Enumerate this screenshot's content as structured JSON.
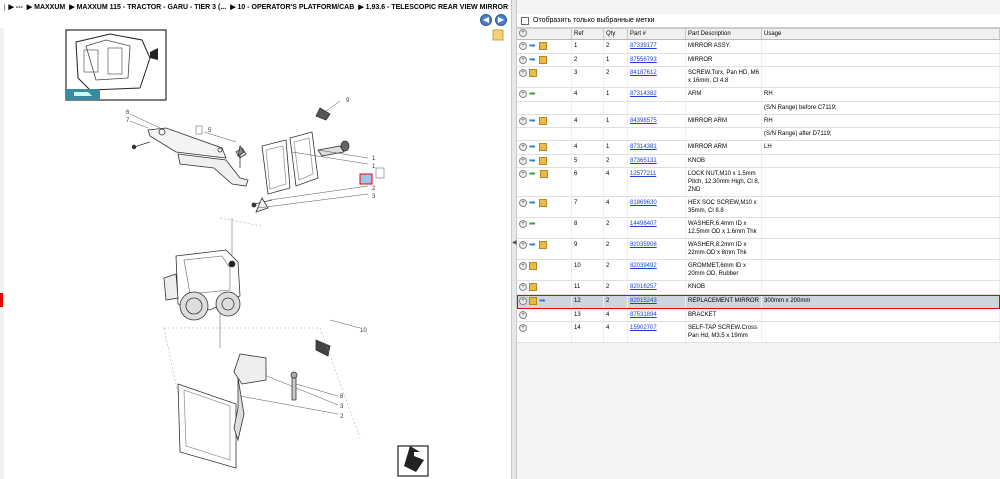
{
  "breadcrumb": {
    "items": [
      "---",
      "MAXXUM",
      "MAXXUM 115 - TRACTOR - GARU - TIER 3 (...",
      "10 - OPERATOR'S PLATFORM/CAB",
      "1.93.6 - TELESCOPIC REAR VIEW MIRROR"
    ]
  },
  "filter": {
    "label": "Отобразить только выбранные метки"
  },
  "columns": [
    "Ref",
    "Qty",
    "Part #",
    "Part Description",
    "Usage"
  ],
  "rows": [
    {
      "icons": [
        "plus",
        "arrow",
        "box"
      ],
      "ref": "1",
      "qty": "2",
      "part": "87339177",
      "desc": "MIRROR ASSY.",
      "usage": ""
    },
    {
      "icons": [
        "plus",
        "arrow",
        "box"
      ],
      "ref": "2",
      "qty": "1",
      "part": "87556793",
      "desc": "MIRROR",
      "usage": ""
    },
    {
      "icons": [
        "plus",
        "box"
      ],
      "ref": "3",
      "qty": "2",
      "part": "84187612",
      "desc": "SCREW,Torx, Pan HD, M6 x 16mm, Cl 4.8",
      "usage": ""
    },
    {
      "icons": [
        "plus",
        "green"
      ],
      "ref": "4",
      "qty": "1",
      "part": "87314382",
      "desc": "ARM",
      "usage": "RH"
    },
    {
      "icons": [],
      "ref": "",
      "qty": "",
      "part": "",
      "desc": "",
      "usage": "(S/N Range) before C7119;"
    },
    {
      "icons": [
        "plus",
        "arrow",
        "box"
      ],
      "ref": "4",
      "qty": "1",
      "part": "84398575",
      "desc": "MIRROR ARM",
      "usage": "RH"
    },
    {
      "icons": [],
      "ref": "",
      "qty": "",
      "part": "",
      "desc": "",
      "usage": "(S/N Range) after D7119;"
    },
    {
      "icons": [
        "plus",
        "arrow",
        "box"
      ],
      "ref": "4",
      "qty": "1",
      "part": "87314381",
      "desc": "MIRROR ARM",
      "usage": "LH"
    },
    {
      "icons": [
        "plus",
        "arrow",
        "box"
      ],
      "ref": "5",
      "qty": "2",
      "part": "87365131",
      "desc": "KNOB",
      "usage": ""
    },
    {
      "icons": [
        "plus",
        "green",
        "box"
      ],
      "ref": "6",
      "qty": "4",
      "part": "12577211",
      "desc": "LOCK NUT,M10 x 1.5mm Pitch, 12.30mm High, Cl 8, ZND",
      "usage": ""
    },
    {
      "icons": [
        "plus",
        "arrow",
        "box"
      ],
      "ref": "7",
      "qty": "4",
      "part": "81869630",
      "desc": "HEX SOC SCREW,M10 x 35mm, Cl 8.8",
      "usage": ""
    },
    {
      "icons": [
        "plus",
        "green"
      ],
      "ref": "8",
      "qty": "2",
      "part": "14496407",
      "desc": "WASHER,6.4mm ID x 12.5mm OD x 1.6mm Thk",
      "usage": ""
    },
    {
      "icons": [
        "plus",
        "arrow",
        "box"
      ],
      "ref": "9",
      "qty": "2",
      "part": "82035908",
      "desc": "WASHER,8.2mm ID x 22mm OD x 8mm Thk",
      "usage": ""
    },
    {
      "icons": [
        "plus",
        "box"
      ],
      "ref": "10",
      "qty": "2",
      "part": "82039492",
      "desc": "GROMMET,6mm ID x 20mm OD, Rubber",
      "usage": ""
    },
    {
      "icons": [
        "plus",
        "box"
      ],
      "ref": "11",
      "qty": "2",
      "part": "82016257",
      "desc": "KNOB",
      "usage": ""
    },
    {
      "icons": [
        "plus",
        "box",
        "arrow"
      ],
      "ref": "12",
      "qty": "2",
      "part": "82015243",
      "desc": "REPLACEMENT MIRROR",
      "usage": "300mm x 200mm",
      "selected": true
    },
    {
      "icons": [
        "plus"
      ],
      "ref": "13",
      "qty": "4",
      "part": "87531894",
      "desc": "BRACKET",
      "usage": ""
    },
    {
      "icons": [
        "plus"
      ],
      "ref": "14",
      "qty": "4",
      "part": "15902707",
      "desc": "SELF-TAP SCREW,Cross Pan Hd, M3.5 x 19mm",
      "usage": ""
    }
  ],
  "callouts": [
    "6",
    "7",
    "5",
    "9",
    "1",
    "1",
    "2",
    "3",
    "4",
    "8",
    "3",
    "2",
    "10"
  ]
}
